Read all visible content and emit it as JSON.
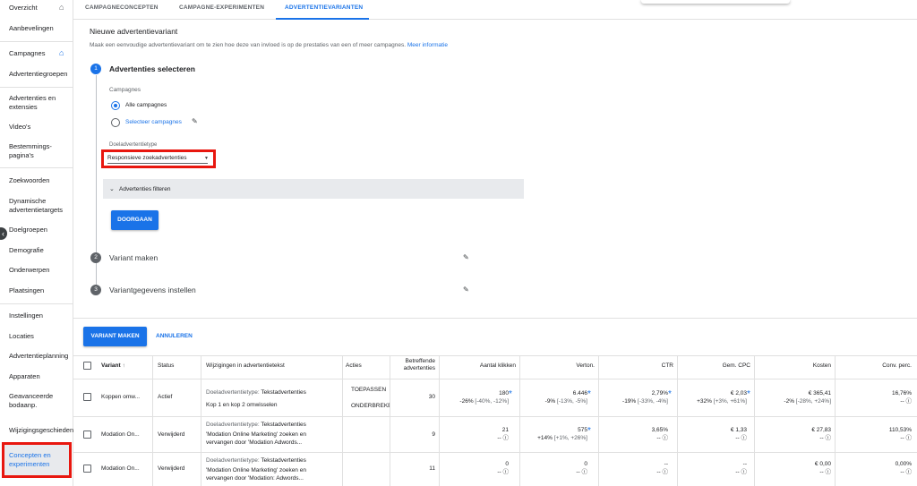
{
  "sidebar": {
    "items": [
      {
        "label": "Overzicht"
      },
      {
        "label": "Aanbevelingen"
      },
      {
        "label": "Campagnes"
      },
      {
        "label": "Advertentiegroepen"
      },
      {
        "label": "Advertenties en extensies"
      },
      {
        "label": "Video's"
      },
      {
        "label": "Bestemmings-pagina's"
      },
      {
        "label": "Zoekwoorden"
      },
      {
        "label": "Dynamische advertentietargets"
      },
      {
        "label": "Doelgroepen"
      },
      {
        "label": "Demografie"
      },
      {
        "label": "Onderwerpen"
      },
      {
        "label": "Plaatsingen"
      },
      {
        "label": "Instellingen"
      },
      {
        "label": "Locaties"
      },
      {
        "label": "Advertentieplanning"
      },
      {
        "label": "Apparaten"
      },
      {
        "label": "Geavanceerde bodaanp."
      },
      {
        "label": "Wijzigingsgeschiedenis"
      },
      {
        "label": "Concepten en experimenten"
      }
    ]
  },
  "tabs": [
    "CAMPAGNECONCEPTEN",
    "CAMPAGNE-EXPERIMENTEN",
    "ADVERTENTIEVARIANTEN"
  ],
  "wizard": {
    "title": "Nieuwe advertentievariant",
    "description": "Maak een eenvoudige advertentievariant om te zien hoe deze van invloed is op de prestaties van een of meer campagnes.",
    "more_info": "Meer informatie",
    "step1": {
      "number": "1",
      "title": "Advertenties selecteren",
      "campaigns_label": "Campagnes",
      "radio_all": "Alle campagnes",
      "radio_select": "Selecteer campagnes",
      "target_type_label": "Doeladvertentietype",
      "target_type_value": "Responsieve zoekadvertenties",
      "filters": "Advertenties filteren",
      "continue": "DOORGAAN"
    },
    "step2": {
      "number": "2",
      "title": "Variant maken"
    },
    "step3": {
      "number": "3",
      "title": "Variantgegevens instellen"
    }
  },
  "actions": {
    "create": "VARIANT MAKEN",
    "cancel": "ANNULEREN"
  },
  "table": {
    "headers": {
      "variant": "Variant",
      "status": "Status",
      "changes": "Wijzigingen in advertentietekst",
      "actions": "Acties",
      "ads_1": "Betreffende",
      "ads_2": "advertenties",
      "clicks": "Aantal klikken",
      "impr": "Verton.",
      "ctr": "CTR",
      "cpc": "Gem. CPC",
      "cost": "Kosten",
      "conv": "Conv. perc."
    },
    "rows": [
      {
        "variant": "Koppen omw...",
        "status": "Actief",
        "change_type": "Doeladvertentietype:",
        "change_type_value": "Tekstadvertenties",
        "change_1": "Kop 1 en kop 2 omwisselen",
        "change_2": "",
        "action_1": "TOEPASSEN",
        "action_2": "ONDERBREKEN",
        "ads": "30",
        "clicks": "180",
        "clicks_delta": "-26%",
        "clicks_range": "[-40%, -12%]",
        "impr": "6.446",
        "impr_delta": "-9%",
        "impr_range": "[-13%, -5%]",
        "ctr": "2,79%",
        "ctr_delta": "-19%",
        "ctr_range": "[-33%, -4%]",
        "cpc": "€ 2,03",
        "cpc_delta": "+32%",
        "cpc_range": "[+3%, +61%]",
        "cost": "€ 365,41",
        "cost_delta": "-2%",
        "cost_range": "[-28%, +24%]",
        "conv": "16,76%",
        "conv_delta": "--"
      },
      {
        "variant": "Modation On...",
        "status": "Verwijderd",
        "change_type": "Doeladvertentietype:",
        "change_type_value": "Tekstadvertenties",
        "change_1": "'Modation Online Marketing' zoeken en",
        "change_2": "vervangen door 'Modation Adwords...",
        "action_1": "",
        "action_2": "",
        "ads": "9",
        "clicks": "21",
        "clicks_delta": "--",
        "clicks_range": "",
        "impr": "575",
        "impr_delta": "+14%",
        "impr_range": "[+1%, +26%]",
        "ctr": "3,65%",
        "ctr_delta": "--",
        "ctr_range": "",
        "cpc": "€ 1,33",
        "cpc_delta": "--",
        "cpc_range": "",
        "cost": "€ 27,83",
        "cost_delta": "--",
        "cost_range": "",
        "conv": "110,53%",
        "conv_delta": "--"
      },
      {
        "variant": "Modation On...",
        "status": "Verwijderd",
        "change_type": "Doeladvertentietype:",
        "change_type_value": "Tekstadvertenties",
        "change_1": "'Modation Online Marketing' zoeken en",
        "change_2": "vervangen door 'Modation: Adwords...",
        "action_1": "",
        "action_2": "",
        "ads": "11",
        "clicks": "0",
        "clicks_delta": "--",
        "clicks_range": "",
        "impr": "0",
        "impr_delta": "--",
        "impr_range": "",
        "ctr": "--",
        "ctr_delta": "--",
        "ctr_range": "",
        "cpc": "--",
        "cpc_delta": "--",
        "cpc_range": "",
        "cost": "€ 0,00",
        "cost_delta": "--",
        "cost_range": "",
        "conv": "0,00%",
        "conv_delta": "--"
      }
    ]
  },
  "colors": {
    "accent": "#1a73e8",
    "highlight": "#e8170f"
  }
}
